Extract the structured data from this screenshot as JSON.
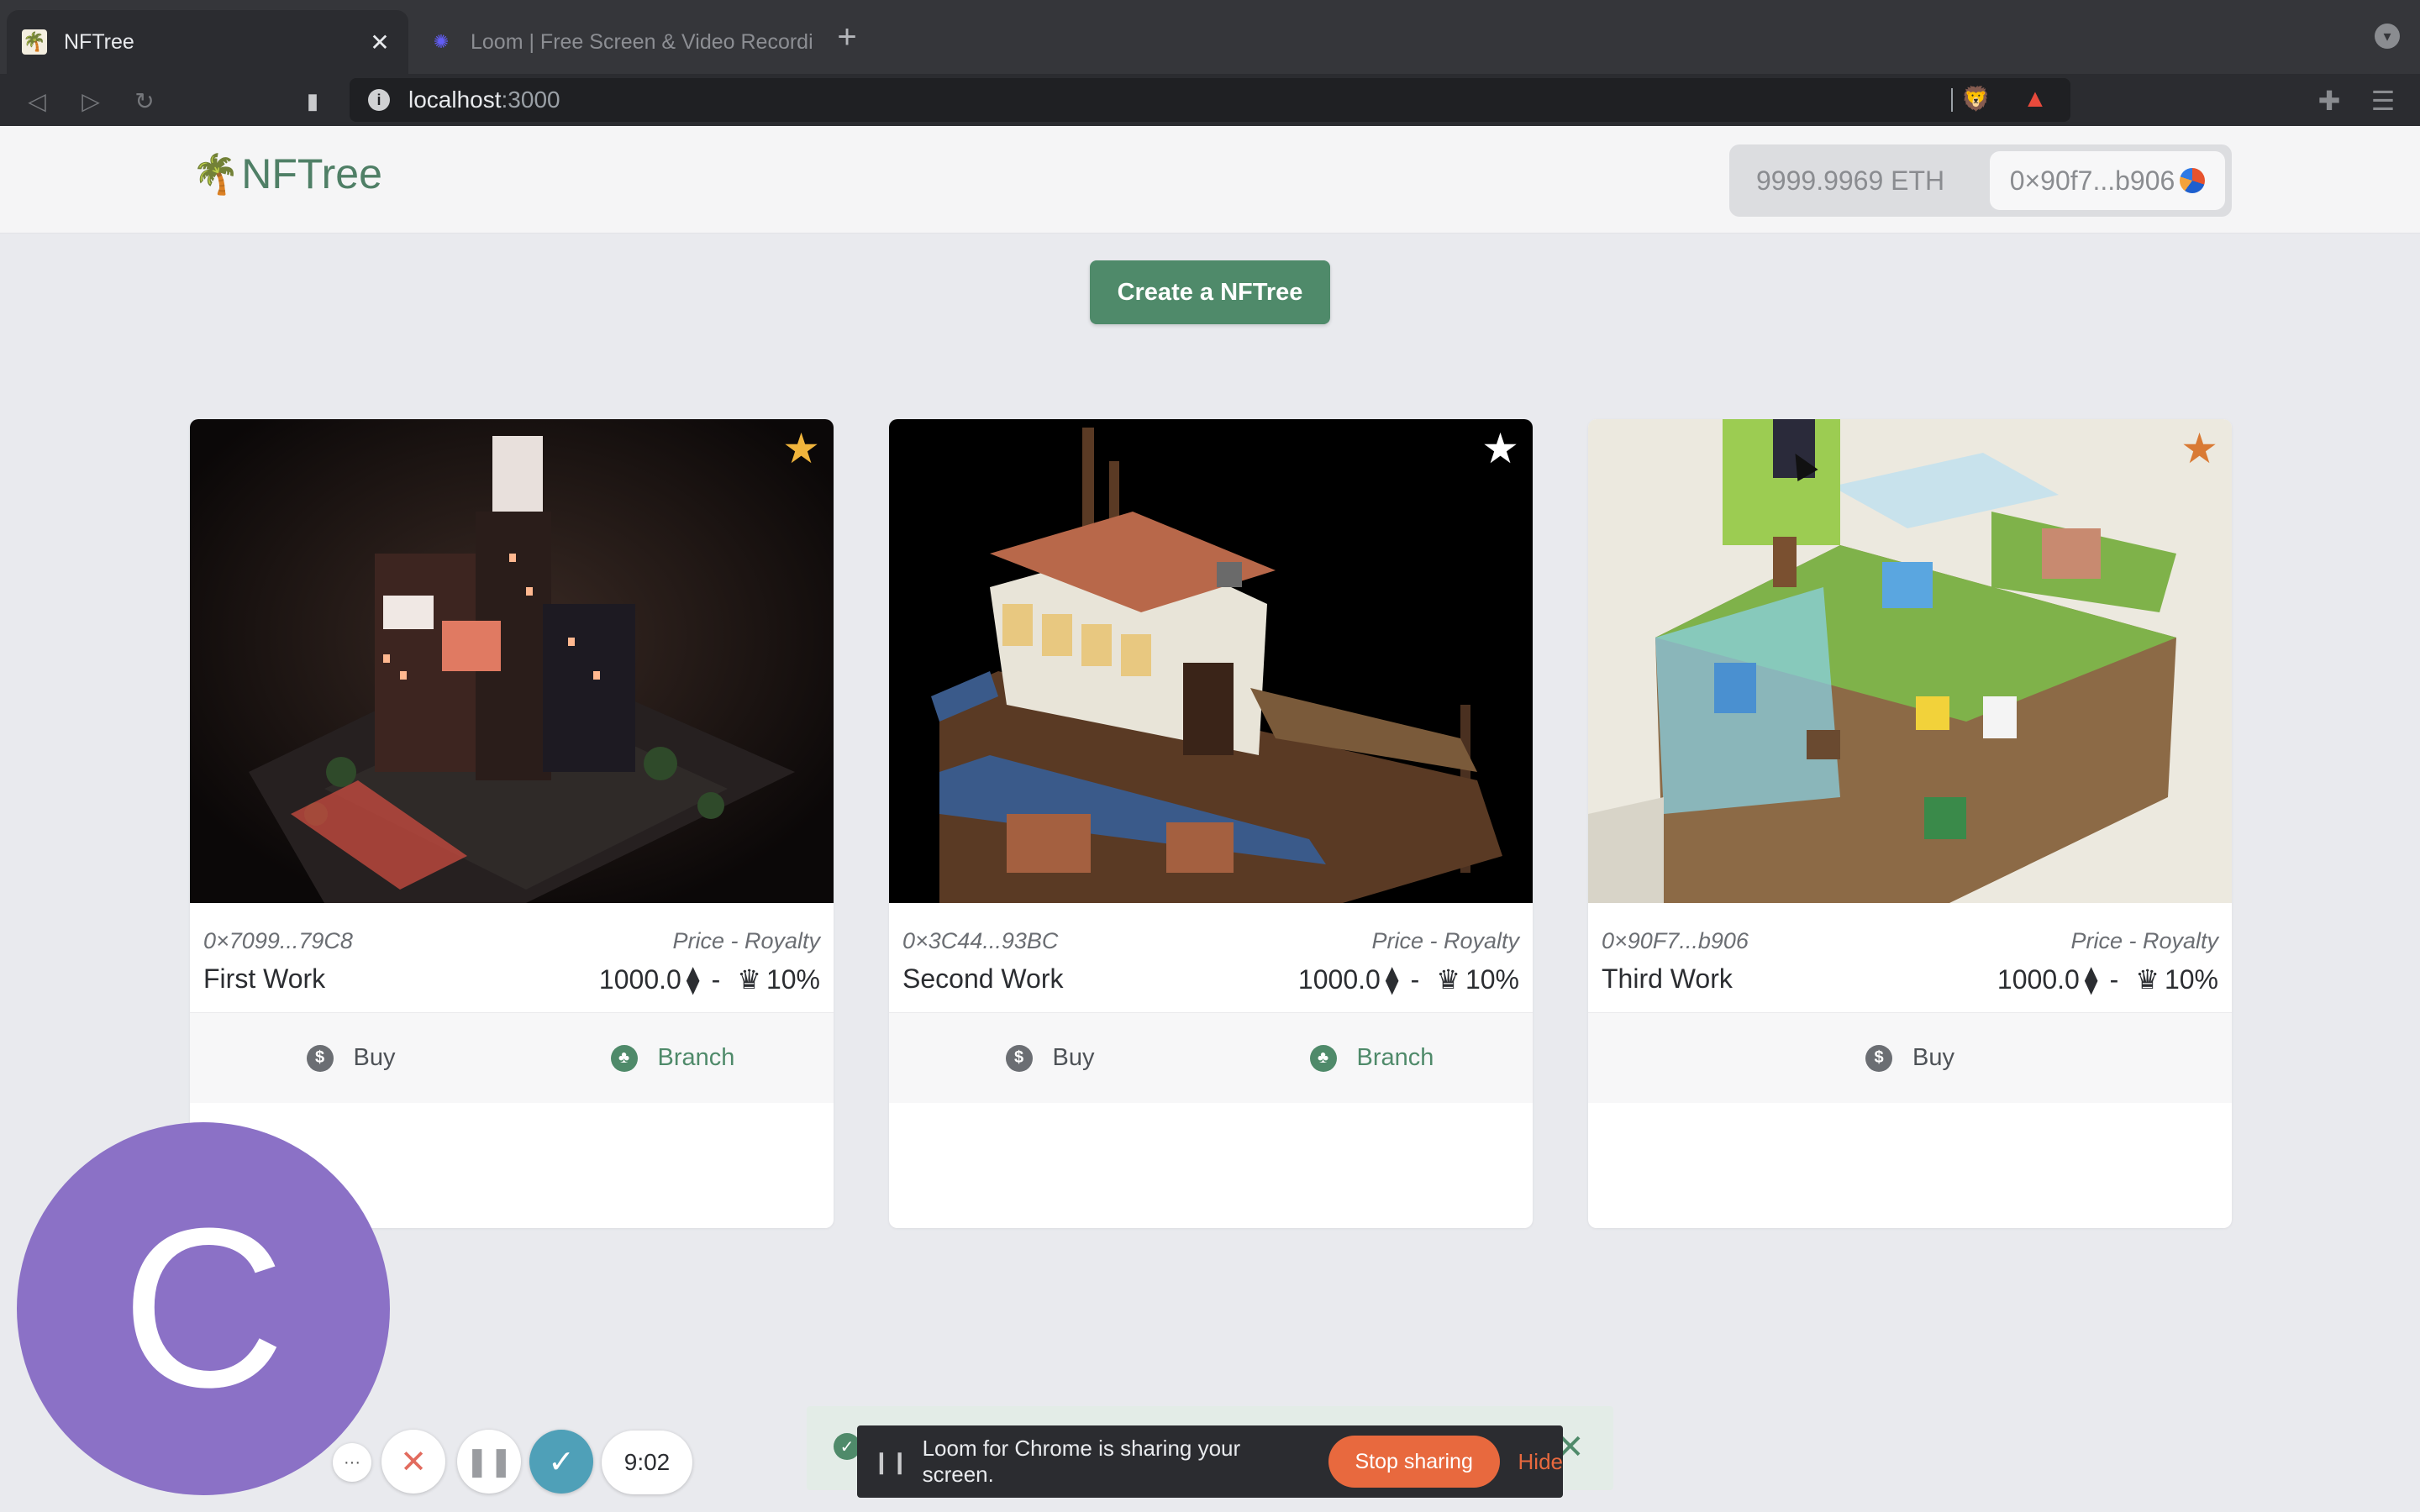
{
  "browser": {
    "tabs": [
      {
        "title": "NFTree",
        "favicon": "palm-tree-icon"
      },
      {
        "title": "Loom | Free Screen & Video Recordi",
        "favicon": "loom-icon"
      }
    ],
    "url_host": "localhost",
    "url_port": ":3000"
  },
  "header": {
    "logo_text": "NFTree",
    "balance": "9999.9969 ETH",
    "account": "0×90f7...b906"
  },
  "create_button": "Create a NFTree",
  "cards": [
    {
      "owner": "0×7099...79C8",
      "labels": "Price  -  Royalty",
      "name": "First Work",
      "price": "1000.0",
      "separator": "-",
      "royalty": "10%",
      "star_color": "#f0b43c",
      "buy": "Buy",
      "branch": "Branch"
    },
    {
      "owner": "0×3C44...93BC",
      "labels": "Price  -  Royalty",
      "name": "Second Work",
      "price": "1000.0",
      "separator": "-",
      "royalty": "10%",
      "star_color": "#ffffff",
      "buy": "Buy",
      "branch": "Branch"
    },
    {
      "owner": "0×90F7...b906",
      "labels": "Price  -  Royalty",
      "name": "Third Work",
      "price": "1000.0",
      "separator": "-",
      "royalty": "10%",
      "star_color": "#d97a34",
      "buy": "Buy"
    }
  ],
  "loom": {
    "avatar_letter": "C",
    "more_label": "···",
    "timer": "9:02",
    "share_message": "Loom for Chrome is sharing your screen.",
    "stop_sharing": "Stop sharing",
    "hide": "Hide"
  }
}
